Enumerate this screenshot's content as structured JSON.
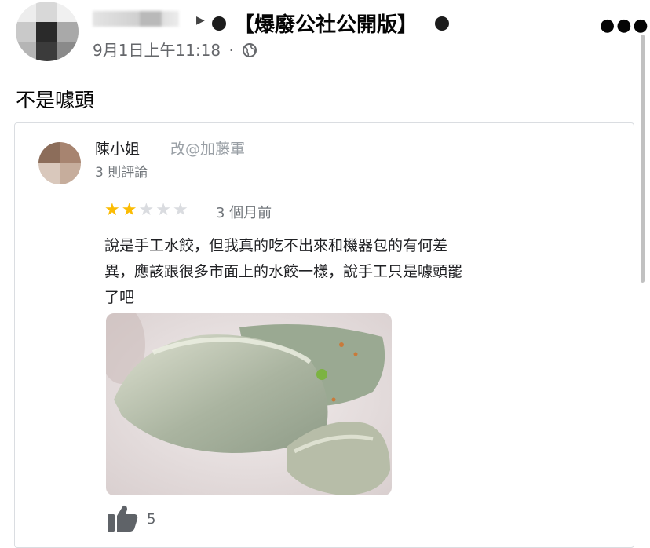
{
  "post": {
    "group_name": "【爆廢公社公開版】",
    "date": "9月1日上午11:18",
    "separator": "·",
    "text": "不是噱頭"
  },
  "review": {
    "reviewer_name": "陳小姐",
    "edited_tag": "改@加藤軍",
    "review_count": "3 則評論",
    "rating": 2,
    "max_rating": 5,
    "time": "3 個月前",
    "body_lines": [
      "說是手工水餃，但我真的吃不出來和機器包的有何差",
      "異，應該跟很多市面上的水餃一樣，說手工只是噱頭罷",
      "了吧"
    ],
    "like_count": "5"
  },
  "icons": {
    "more": "more-icon",
    "globe": "globe-icon",
    "thumb": "thumbs-up-icon",
    "arrow": "arrow-right-icon"
  },
  "colors": {
    "star_filled": "#fbbc04",
    "star_empty": "#dadce0",
    "meta_gray": "#65676b"
  }
}
